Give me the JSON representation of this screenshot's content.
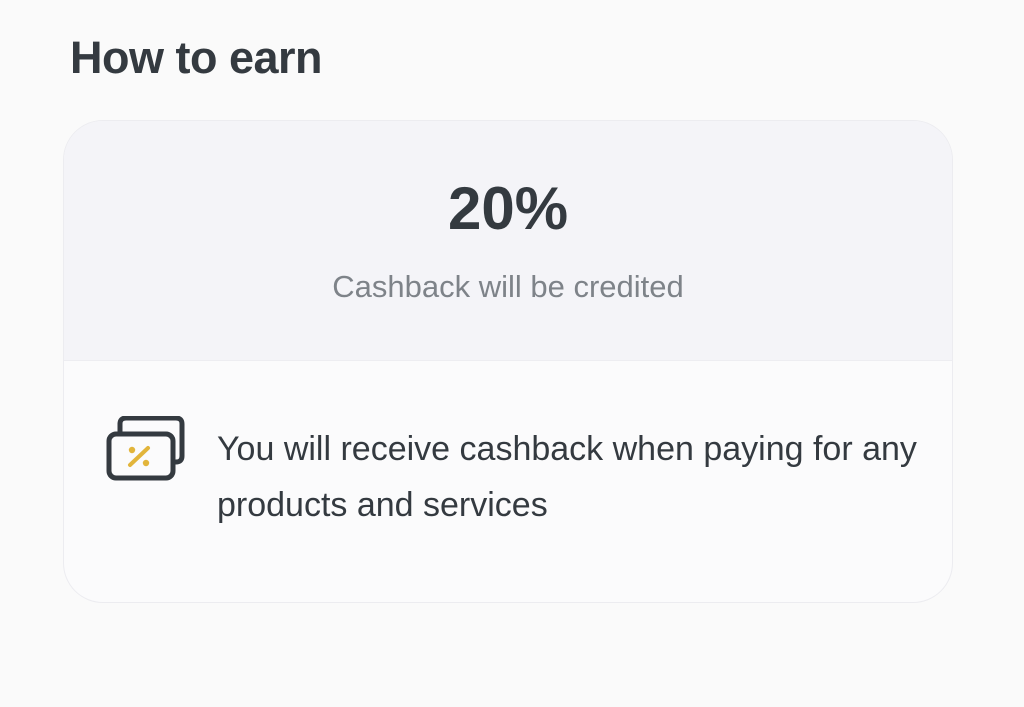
{
  "page": {
    "title": "How to earn"
  },
  "card": {
    "rate": "20%",
    "rate_caption": "Cashback will be credited",
    "description": "You will receive cashback when paying for any products and services",
    "icon": "cashback-card-icon",
    "colors": {
      "icon_stroke": "#343a40",
      "icon_accent": "#e2b53b"
    }
  }
}
